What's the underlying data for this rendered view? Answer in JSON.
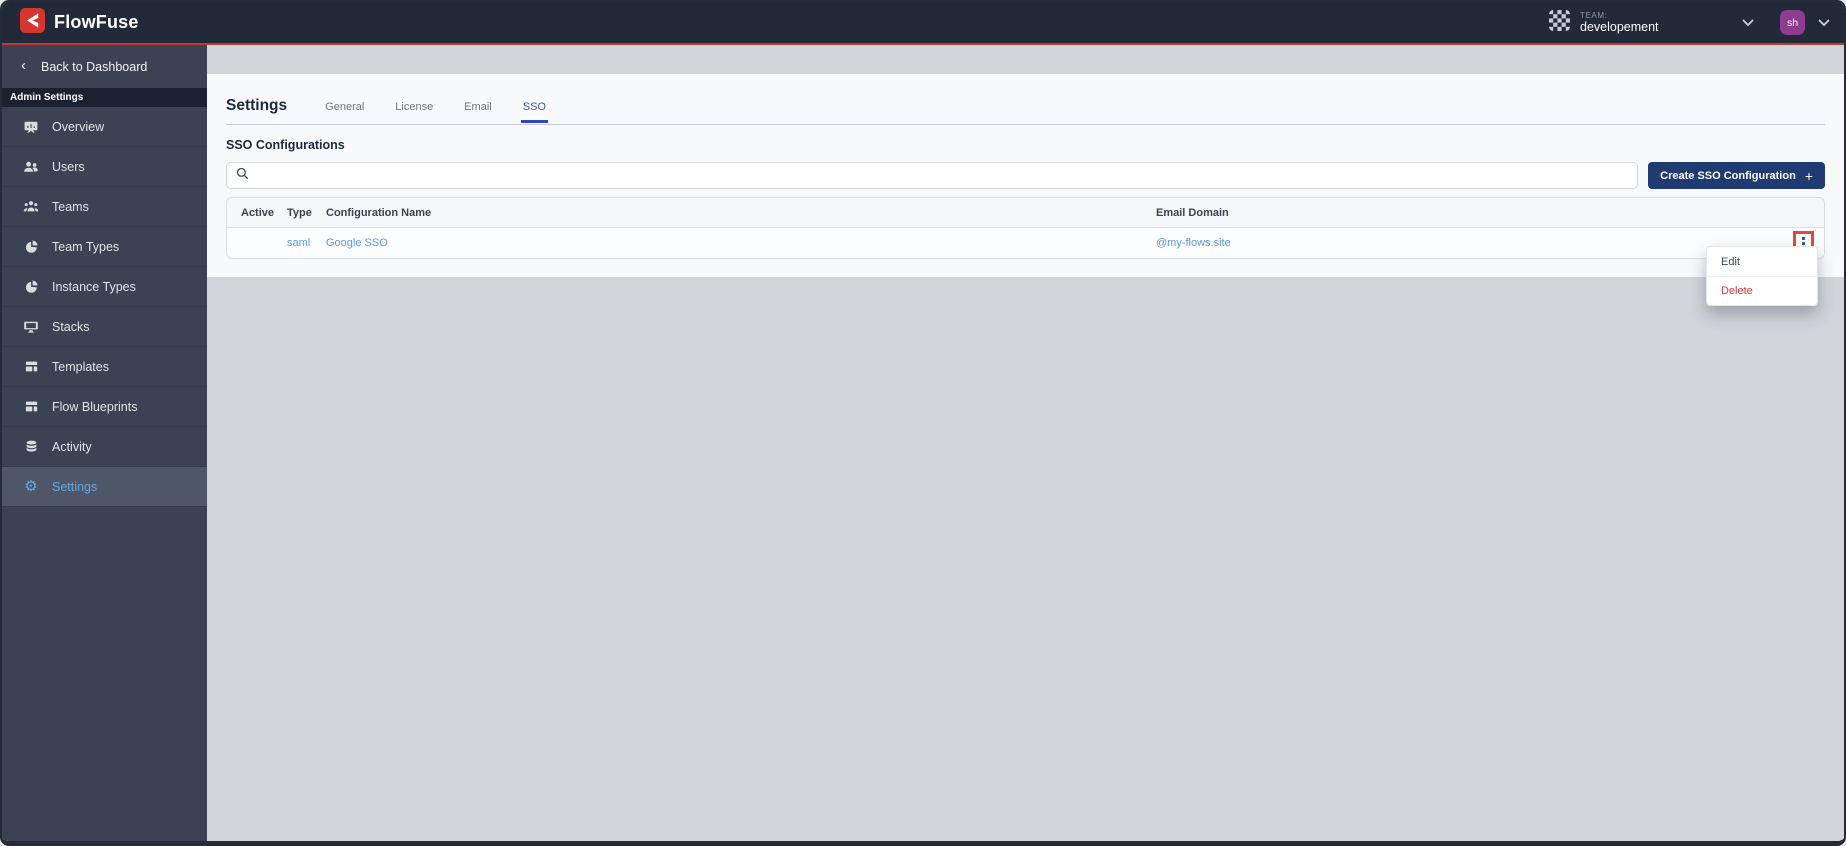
{
  "header": {
    "brand": "FlowFuse",
    "team_label": "TEAM:",
    "team_name": "developement",
    "avatar_initials": "sh"
  },
  "sidebar": {
    "back_label": "Back to Dashboard",
    "section_label": "Admin Settings",
    "items": [
      {
        "label": "Overview"
      },
      {
        "label": "Users"
      },
      {
        "label": "Teams"
      },
      {
        "label": "Team Types"
      },
      {
        "label": "Instance Types"
      },
      {
        "label": "Stacks"
      },
      {
        "label": "Templates"
      },
      {
        "label": "Flow Blueprints"
      },
      {
        "label": "Activity"
      },
      {
        "label": "Settings"
      }
    ],
    "active_item": "Settings"
  },
  "content": {
    "page_title": "Settings",
    "tabs": [
      "General",
      "License",
      "Email",
      "SSO"
    ],
    "active_tab": "SSO",
    "section_title": "SSO Configurations",
    "search": {
      "value": "",
      "placeholder": ""
    },
    "create_button_label": "Create SSO Configuration",
    "create_button_plus": "+",
    "table": {
      "headers": [
        "Active",
        "Type",
        "Configuration Name",
        "Email Domain"
      ],
      "rows": [
        {
          "active": "",
          "type": "saml",
          "name": "Google SSO",
          "email_domain": "@my-flows.site"
        }
      ]
    },
    "context_menu": {
      "edit_label": "Edit",
      "delete_label": "Delete"
    }
  },
  "colors": {
    "header_bg": "#222938",
    "brand_red_line": "#bf3a30",
    "logo_red": "#d8352e",
    "sidebar_bg": "#3a4253",
    "sidebar_active_bg": "#4e5767",
    "active_blue": "#66a7e3",
    "tab_active_indigo": "#4550ca",
    "link_blue": "#5f97e3",
    "button_navy": "#203a72",
    "danger_red": "#cf3c3c",
    "highlight_box_red": "#e0493e",
    "page_gray": "#d2d4da",
    "card_bg": "#f8f9fb",
    "avatar_purple": "#8e3d8e"
  }
}
